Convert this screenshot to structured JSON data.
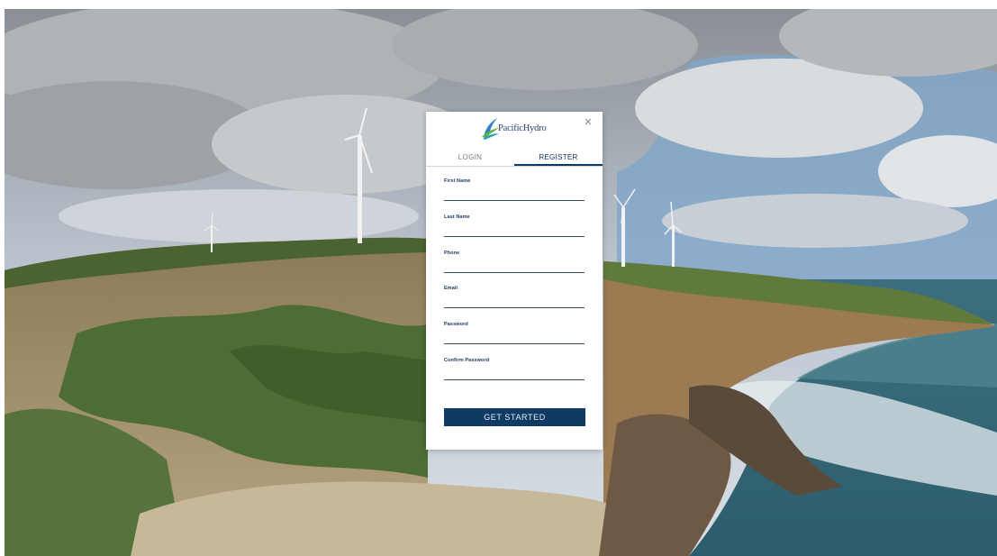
{
  "brand": {
    "logo_text": "PacificHydro"
  },
  "modal": {
    "close_glyph": "×"
  },
  "tabs": [
    {
      "label": "LOGIN",
      "active": false
    },
    {
      "label": "REGISTER",
      "active": true
    }
  ],
  "form": {
    "fields": [
      {
        "label": "First Name",
        "value": ""
      },
      {
        "label": "Last Name",
        "value": ""
      },
      {
        "label": "Phone",
        "value": ""
      },
      {
        "label": "Email",
        "value": ""
      },
      {
        "label": "Password",
        "value": ""
      },
      {
        "label": "Confirm Password",
        "value": ""
      }
    ],
    "submit_label": "GET STARTED"
  },
  "colors": {
    "accent": "#0e3a63",
    "label": "#223a5e",
    "logo_text": "#2a3f6a"
  },
  "icons": {
    "close": "close-icon",
    "logo": "pacific-hydro-logo"
  }
}
